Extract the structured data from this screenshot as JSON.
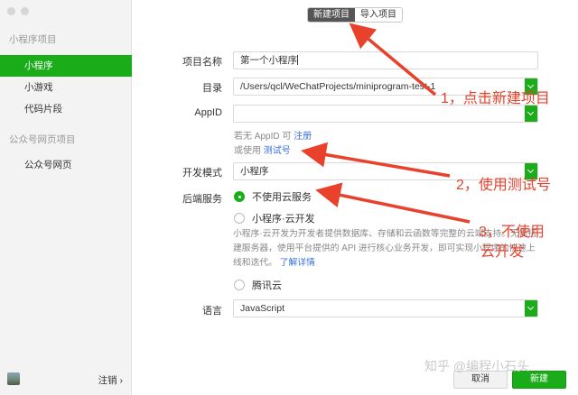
{
  "sidebar": {
    "groups": [
      {
        "title": "小程序项目",
        "items": [
          "小程序",
          "小游戏",
          "代码片段"
        ]
      },
      {
        "title": "公众号网页项目",
        "items": [
          "公众号网页"
        ]
      }
    ],
    "footer": {
      "logout_label": "注销 ›"
    }
  },
  "header": {
    "tabs": {
      "new_project": "新建项目",
      "import_project": "导入项目"
    }
  },
  "form": {
    "project_name": {
      "label": "项目名称",
      "value": "第一个小程序"
    },
    "directory": {
      "label": "目录",
      "value": "/Users/qcl/WeChatProjects/miniprogram-test-1"
    },
    "appid": {
      "label": "AppID",
      "value": "",
      "hint_prefix": "若无 AppID 可",
      "register_link": "注册",
      "hint_prefix2": "或使用",
      "test_link": "测试号"
    },
    "dev_mode": {
      "label": "开发模式",
      "value": "小程序"
    },
    "backend": {
      "label": "后端服务",
      "options": {
        "no_cloud": "不使用云服务",
        "cloud": "小程序·云开发",
        "tencent": "腾讯云"
      },
      "description": "小程序·云开发为开发者提供数据库、存储和云函数等完整的云端支持。无需搭建服务器，使用平台提供的 API 进行核心业务开发，即可实现小程序的快速上线和迭代。",
      "learn_more": "了解详情"
    },
    "language": {
      "label": "语言",
      "value": "JavaScript"
    }
  },
  "buttons": {
    "cancel": "取消",
    "create": "新建"
  },
  "annotations": {
    "step1": "1，点击新建项目",
    "step2": "2，使用测试号",
    "step3_line1": "3，不使用",
    "step3_line2": "云开发",
    "color": "#e8412c"
  },
  "watermark": "知乎 @编程小石头",
  "colors": {
    "accent": "#1aad19",
    "link": "#3a6fd8"
  }
}
